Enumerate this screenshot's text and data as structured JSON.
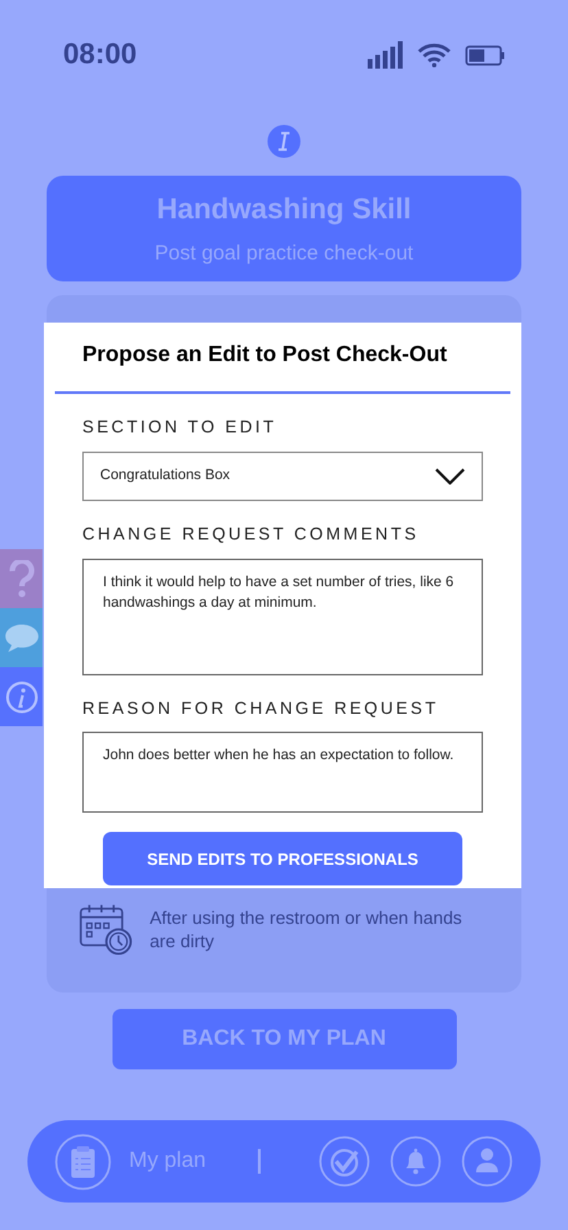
{
  "status_bar": {
    "time": "08:00"
  },
  "header": {
    "title": "Handwashing Skill",
    "subtitle": "Post goal practice check-out"
  },
  "card": {
    "schedule_text": "After using the restroom or when hands are dirty"
  },
  "back_button": "BACK TO MY PLAN",
  "side_tabs": [
    {
      "kind": "help",
      "color": "#9b80c8"
    },
    {
      "kind": "chat",
      "color": "#4e9fdd"
    },
    {
      "kind": "info",
      "color": "#5671fd"
    }
  ],
  "nav": {
    "plan_label": "My plan",
    "icons": [
      {
        "kind": "check"
      },
      {
        "kind": "bell"
      },
      {
        "kind": "user"
      }
    ]
  },
  "modal": {
    "title": "Propose an Edit to Post Check-Out",
    "fields": [
      {
        "kind": "select",
        "label": "SECTION TO EDIT",
        "value": "Congratulations Box"
      },
      {
        "kind": "textarea",
        "label": "CHANGE REQUEST COMMENTS",
        "value": "I think it would help to have a set number of tries, like 6 handwashings a day at minimum."
      },
      {
        "kind": "textarea",
        "label": "REASON FOR CHANGE REQUEST",
        "value": "John does better when he has an expectation to follow."
      }
    ],
    "button": "SEND EDITS TO PROFESSIONALS"
  }
}
